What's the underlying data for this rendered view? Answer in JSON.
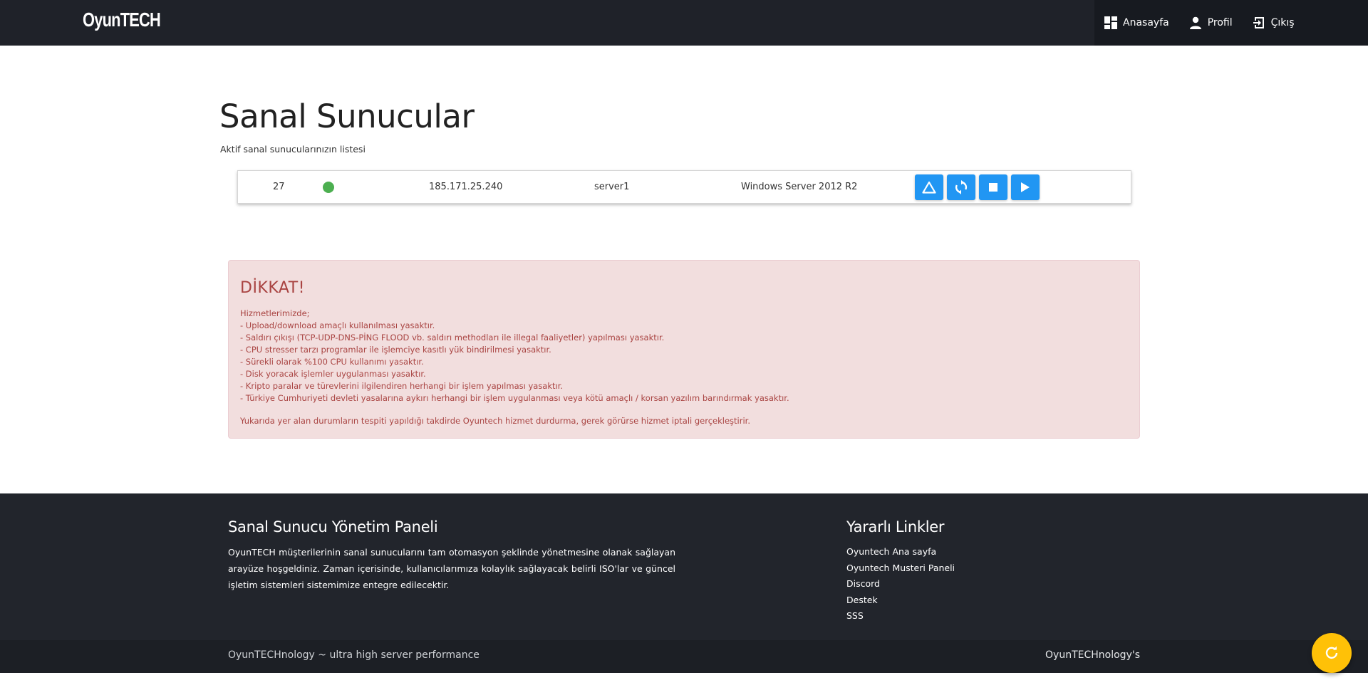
{
  "navbar": {
    "brand": "OyunTECH",
    "items": [
      {
        "label": "Anasayfa",
        "icon": "dashboard-icon"
      },
      {
        "label": "Profil",
        "icon": "person-icon"
      },
      {
        "label": "Çıkış",
        "icon": "exit-icon"
      }
    ]
  },
  "main": {
    "title": "Sanal Sunucular",
    "subtitle": "Aktif sanal sunucularınızın listesi",
    "server": {
      "id": "27",
      "status": "online",
      "status_color": "#4caf50",
      "ip": "185.171.25.240",
      "name": "server1",
      "os": "Windows Server 2012 R2",
      "actions": [
        {
          "icon": "warning-triangle-icon"
        },
        {
          "icon": "restart-icon"
        },
        {
          "icon": "stop-icon"
        },
        {
          "icon": "play-icon"
        }
      ],
      "action_color": "#2196f3"
    }
  },
  "alert": {
    "title": "DİKKAT!",
    "intro": "Hizmetlerimizde;",
    "lines": [
      "- Upload/download amaçlı kullanılması yasaktır.",
      "- Saldırı çıkışı (TCP-UDP-DNS-PİNG FLOOD vb. saldırı methodları ile illegal faaliyetler) yapılması yasaktır.",
      "- CPU stresser tarzı programlar ile işlemciye kasıtlı yük bindirilmesi yasaktır.",
      "- Sürekli olarak %100 CPU kullanımı yasaktır.",
      "- Disk yoracak işlemler uygulanması yasaktır.",
      "- Kripto paralar ve türevlerini ilgilendiren herhangi bir işlem yapılması yasaktır.",
      "- Türkiye Cumhuriyeti devleti yasalarına aykırı herhangi bir işlem uygulanması veya kötü amaçlı / korsan yazılım barındırmak yasaktır."
    ],
    "closing": "Yukarıda yer alan durumların tespiti yapıldığı takdirde Oyuntech hizmet durdurma, gerek görürse hizmet iptali gerçekleştirir."
  },
  "footer": {
    "about_title": "Sanal Sunucu Yönetim Paneli",
    "about_text": "OyunTECH müşterilerinin sanal sunucularını tam otomasyon şeklinde yönetmesine olanak sağlayan arayüze hoşgeldiniz. Zaman içerisinde, kullanıcılarımıza kolaylık sağlayacak belirli ISO'lar ve güncel işletim sistemleri sistemimize entegre edilecektir.",
    "links_title": "Yararlı Linkler",
    "links": [
      "Oyuntech Ana sayfa",
      "Oyuntech Musteri Paneli",
      "Discord",
      "Destek",
      "SSS"
    ],
    "bottom_left": "OyunTECHnology ~ ultra high server performance",
    "bottom_right": "OyunTECHnology's"
  },
  "fab": {
    "icon": "refresh-icon",
    "color": "#ffc107"
  }
}
